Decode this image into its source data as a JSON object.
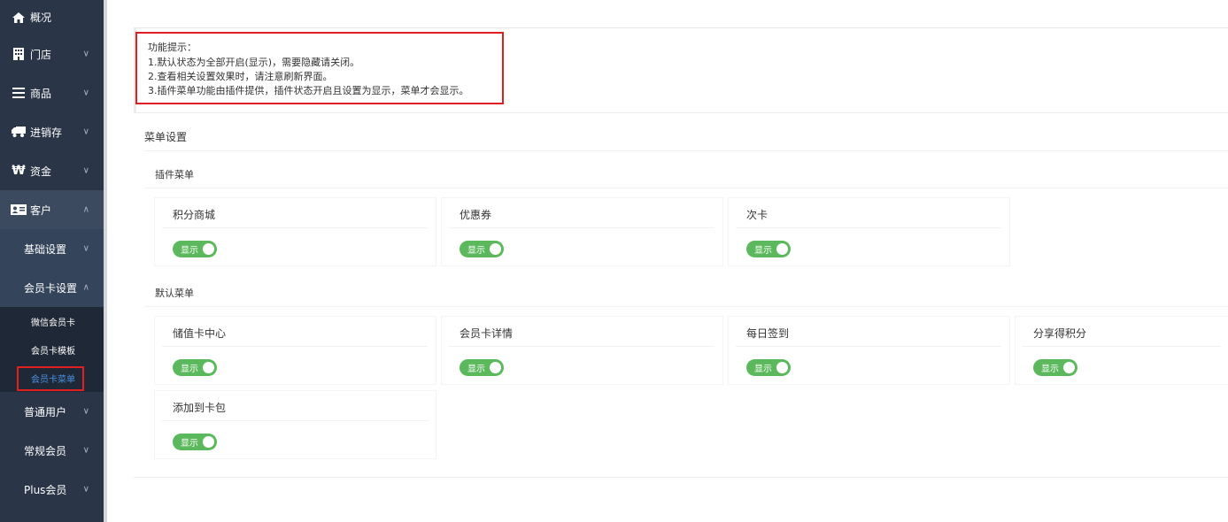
{
  "sidebar": {
    "items": [
      {
        "label": "概况",
        "icon": "home-icon"
      },
      {
        "label": "门店",
        "icon": "building-icon"
      },
      {
        "label": "商品",
        "icon": "list-icon"
      },
      {
        "label": "进销存",
        "icon": "truck-icon"
      },
      {
        "label": "资金",
        "icon": "won-icon"
      },
      {
        "label": "客户",
        "icon": "id-card-icon"
      }
    ],
    "sub_items": [
      {
        "label": "基础设置"
      },
      {
        "label": "会员卡设置"
      }
    ],
    "leaf_items": [
      {
        "label": "微信会员卡"
      },
      {
        "label": "会员卡模板"
      },
      {
        "label": "会员卡菜单"
      }
    ],
    "bottom_items": [
      {
        "label": "普通用户"
      },
      {
        "label": "常规会员"
      },
      {
        "label": "Plus会员"
      }
    ]
  },
  "tips": {
    "title": "功能提示：",
    "lines": [
      "1.默认状态为全部开启(显示)，需要隐藏请关闭。",
      "2.查看相关设置效果时，请注意刷新界面。",
      "3.插件菜单功能由插件提供，插件状态开启且设置为显示，菜单才会显示。"
    ]
  },
  "panel": {
    "title": "菜单设置",
    "plugin_group": {
      "title": "插件菜单",
      "cards": [
        {
          "label": "积分商城",
          "toggle": "显示"
        },
        {
          "label": "优惠券",
          "toggle": "显示"
        },
        {
          "label": "次卡",
          "toggle": "显示"
        }
      ]
    },
    "default_group": {
      "title": "默认菜单",
      "cards": [
        {
          "label": "储值卡中心",
          "toggle": "显示"
        },
        {
          "label": "会员卡详情",
          "toggle": "显示"
        },
        {
          "label": "每日签到",
          "toggle": "显示"
        },
        {
          "label": "分享得积分",
          "toggle": "显示"
        },
        {
          "label": "添加到卡包",
          "toggle": "显示"
        }
      ]
    }
  },
  "colors": {
    "sidebar_bg": "#2a3547",
    "toggle_on": "#5cb85c",
    "highlight_border": "#e02020",
    "active_link": "#4a90e2"
  }
}
